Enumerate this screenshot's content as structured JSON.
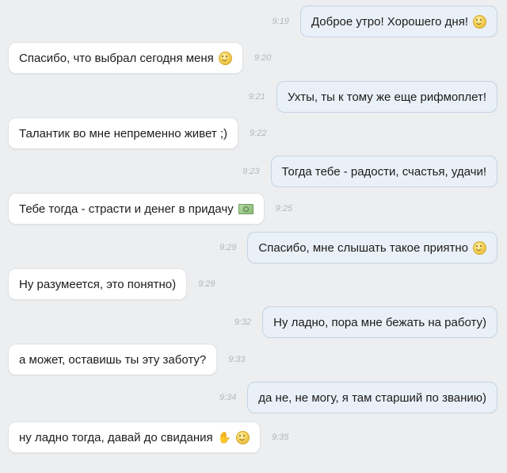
{
  "messages": [
    {
      "direction": "out",
      "text": "Доброе утро! Хорошего дня!",
      "time": "9:19",
      "emoji": [
        "smile"
      ]
    },
    {
      "direction": "in",
      "text": "Спасибо, что выбрал сегодня меня",
      "time": "9:20",
      "emoji": [
        "smile"
      ]
    },
    {
      "direction": "out",
      "text": "Ухты, ты к тому же еще рифмоплет!",
      "time": "9:21",
      "emoji": []
    },
    {
      "direction": "in",
      "text": "Талантик во мне непременно живет ;)",
      "time": "9:22",
      "emoji": []
    },
    {
      "direction": "out",
      "text": "Тогда тебе - радости, счастья, удачи!",
      "time": "9:23",
      "emoji": []
    },
    {
      "direction": "in",
      "text": "Тебе тогда - страсти и денег в придачу",
      "time": "9:25",
      "emoji": [
        "money"
      ]
    },
    {
      "direction": "out",
      "text": "Спасибо, мне слышать такое приятно",
      "time": "9:29",
      "emoji": [
        "smile"
      ]
    },
    {
      "direction": "in",
      "text": "Ну разумеется, это понятно)",
      "time": "9:29",
      "emoji": []
    },
    {
      "direction": "out",
      "text": "Ну ладно, пора мне бежать на работу)",
      "time": "9:32",
      "emoji": []
    },
    {
      "direction": "in",
      "text": "а может, оставишь ты эту заботу?",
      "time": "9:33",
      "emoji": []
    },
    {
      "direction": "out",
      "text": "да не, не могу, я там старший по званию)",
      "time": "9:34",
      "emoji": []
    },
    {
      "direction": "in",
      "text": "ну ладно тогда, давай до свидания",
      "time": "9:35",
      "emoji": [
        "waving-hand",
        "smile"
      ]
    }
  ],
  "colors": {
    "background": "#edeef0",
    "incoming_bubble": "#ffffff",
    "outgoing_bubble": "#eaf0f7",
    "time_text": "#b2b7bf"
  }
}
